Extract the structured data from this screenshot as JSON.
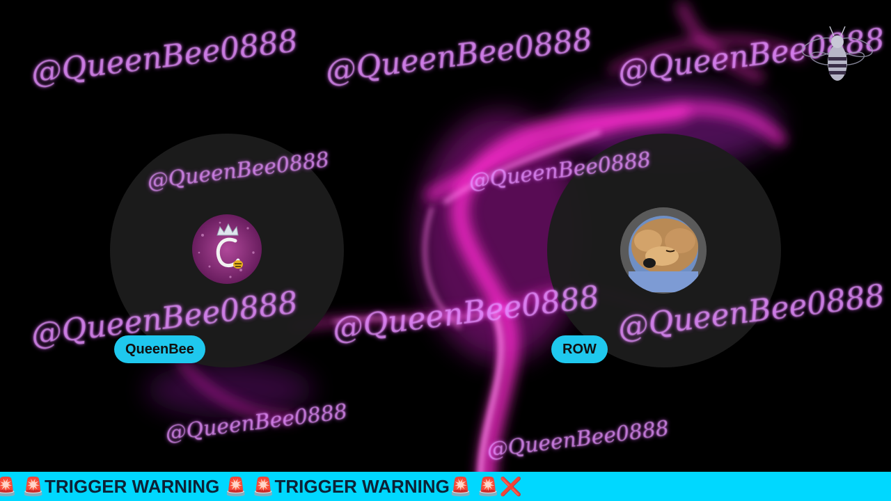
{
  "watermark_text": "@QueenBee0888",
  "participants": [
    {
      "name": "QueenBee",
      "avatar": "crown-letter-avatar"
    },
    {
      "name": "ROW",
      "avatar": "dog-photo-avatar"
    }
  ],
  "ticker": {
    "text": "🚨 🚨TRIGGER WARNING 🚨 🚨TRIGGER WARNING🚨  🚨❌"
  },
  "colors": {
    "accent": "#1fc8ee",
    "ticker_bg": "#00d8ff",
    "tile_bg": "#1c1c1c",
    "smoke": "#ff3cd2"
  },
  "icons": [
    "bee-logo-icon",
    "siren-icon",
    "cross-mark-icon"
  ]
}
